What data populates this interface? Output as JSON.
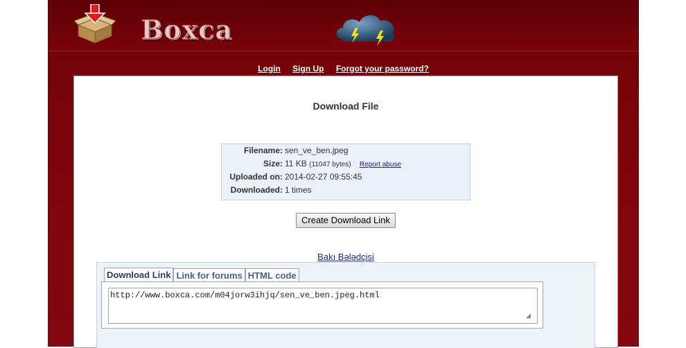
{
  "header": {
    "logo_text": "Boxca",
    "nav": [
      {
        "label": "Login"
      },
      {
        "label": "Sign Up"
      },
      {
        "label": "Forgot your password?"
      }
    ]
  },
  "main": {
    "title": "Download File",
    "file_info": {
      "filename_label": "Filename:",
      "filename": "sen_ve_ben.jpeg",
      "size_label": "Size:",
      "size": "11 KB",
      "size_bytes": "(11047 bytes)",
      "report_label": "Report abuse",
      "uploaded_label": "Uploaded on:",
      "uploaded": "2014-02-27 09:55:45",
      "downloaded_label": "Downloaded:",
      "downloaded": "1 times"
    },
    "create_button": "Create Download Link",
    "ad_link": "Bakı Bələdçisi",
    "tabs": [
      {
        "label": "Download Link",
        "active": true
      },
      {
        "label": "Link for forums"
      },
      {
        "label": "HTML code"
      }
    ],
    "link_value": "http://www.boxca.com/m04jorw3ihjq/sen_ve_ben.jpeg.html"
  },
  "colors": {
    "header_bg": "#6e0208",
    "info_bg": "#eaf1f9",
    "link_blue": "#1a2b8c"
  }
}
